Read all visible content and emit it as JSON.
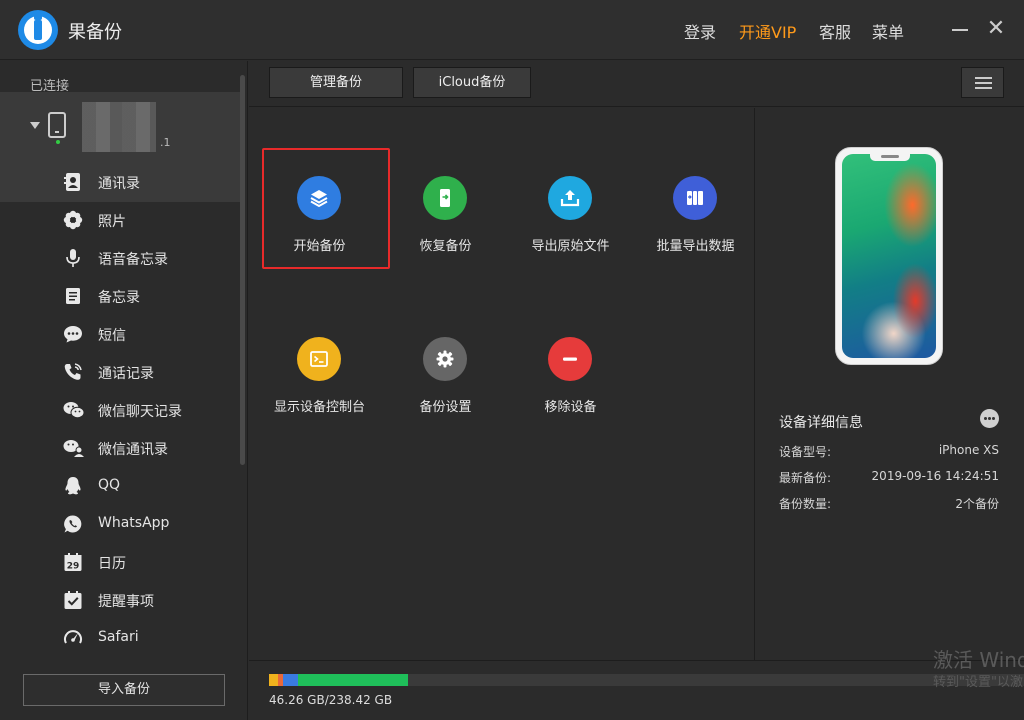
{
  "app": {
    "title": "果备份"
  },
  "topnav": {
    "login": "登录",
    "vip": "开通VIP",
    "service": "客服",
    "menu": "菜单"
  },
  "sidebar": {
    "connected_label": "已连接",
    "device_suffix": ".1",
    "items": [
      {
        "label": "通讯录",
        "icon": "contacts-icon"
      },
      {
        "label": "照片",
        "icon": "photos-icon"
      },
      {
        "label": "语音备忘录",
        "icon": "microphone-icon"
      },
      {
        "label": "备忘录",
        "icon": "notes-icon"
      },
      {
        "label": "短信",
        "icon": "message-icon"
      },
      {
        "label": "通话记录",
        "icon": "phone-call-icon"
      },
      {
        "label": "微信聊天记录",
        "icon": "wechat-icon"
      },
      {
        "label": "微信通讯录",
        "icon": "wechat-contacts-icon"
      },
      {
        "label": "QQ",
        "icon": "qq-icon"
      },
      {
        "label": "WhatsApp",
        "icon": "whatsapp-icon"
      },
      {
        "label": "日历",
        "icon": "calendar-icon",
        "badge": "29"
      },
      {
        "label": "提醒事项",
        "icon": "reminder-icon"
      },
      {
        "label": "Safari",
        "icon": "safari-icon"
      }
    ],
    "import_button": "导入备份"
  },
  "toolbar": {
    "manage_tab": "管理备份",
    "icloud_tab": "iCloud备份"
  },
  "actions": [
    {
      "label": "开始备份",
      "icon": "layers-icon",
      "color": "#2f7de1",
      "selected": true
    },
    {
      "label": "恢复备份",
      "icon": "phone-restore-icon",
      "color": "#2fb04c"
    },
    {
      "label": "导出原始文件",
      "icon": "upload-tray-icon",
      "color": "#1fa8e0"
    },
    {
      "label": "批量导出数据",
      "icon": "batch-export-icon",
      "color": "#3f5fd8"
    },
    {
      "label": "显示设备控制台",
      "icon": "terminal-icon",
      "color": "#f0b21d"
    },
    {
      "label": "备份设置",
      "icon": "gear-icon",
      "color": "#666666"
    },
    {
      "label": "移除设备",
      "icon": "minus-circle-icon",
      "color": "#e63b3b"
    }
  ],
  "device_details": {
    "title": "设备详细信息",
    "rows": [
      {
        "key": "设备型号:",
        "value": "iPhone XS"
      },
      {
        "key": "最新备份:",
        "value": "2019-09-16 14:24:51"
      },
      {
        "key": "备份数量:",
        "value": "2个备份"
      }
    ]
  },
  "storage": {
    "text": "46.26 GB/238.42 GB",
    "used_fraction": 0.194,
    "segments": [
      {
        "color": "#f0b21d",
        "fraction": 0.0119
      },
      {
        "color": "#e8683a",
        "fraction": 0.006
      },
      {
        "color": "#3a7be0",
        "fraction": 0.0198
      },
      {
        "color": "#1fbf5a",
        "fraction": 0.1457
      }
    ]
  },
  "watermark": {
    "line1": "激活 Wind",
    "line2": "转到\"设置\"以激"
  }
}
